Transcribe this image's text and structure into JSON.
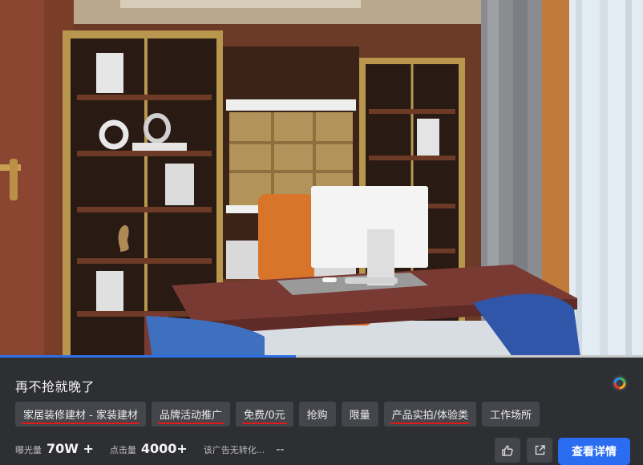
{
  "ad": {
    "title": "再不抢就晚了",
    "brand_icon": "colorful-circle-icon",
    "progress_fraction": 0.46,
    "tags": [
      {
        "label": "家居装修建材 - 家装建材",
        "underlined": true
      },
      {
        "label": "品牌活动推广",
        "underlined": true
      },
      {
        "label": "免费/0元",
        "underlined": true
      },
      {
        "label": "抢购",
        "underlined": false
      },
      {
        "label": "限量",
        "underlined": false
      },
      {
        "label": "产品实拍/体验类",
        "underlined": true
      },
      {
        "label": "工作场所",
        "underlined": false
      }
    ],
    "stats": {
      "exposure_label": "曝光量",
      "exposure_value": "70W +",
      "clicks_label": "点击量",
      "clicks_value": "4000+",
      "conversion_note": "该广告无转化...",
      "conversion_value": "--"
    },
    "actions": {
      "like_icon": "thumbs-up-icon",
      "share_icon": "external-link-icon",
      "detail_label": "查看详情"
    },
    "colors": {
      "accent": "#2b6df0",
      "underline": "#e0191c",
      "panel_bg": "#2e2f33",
      "tag_bg": "#45464b"
    }
  }
}
